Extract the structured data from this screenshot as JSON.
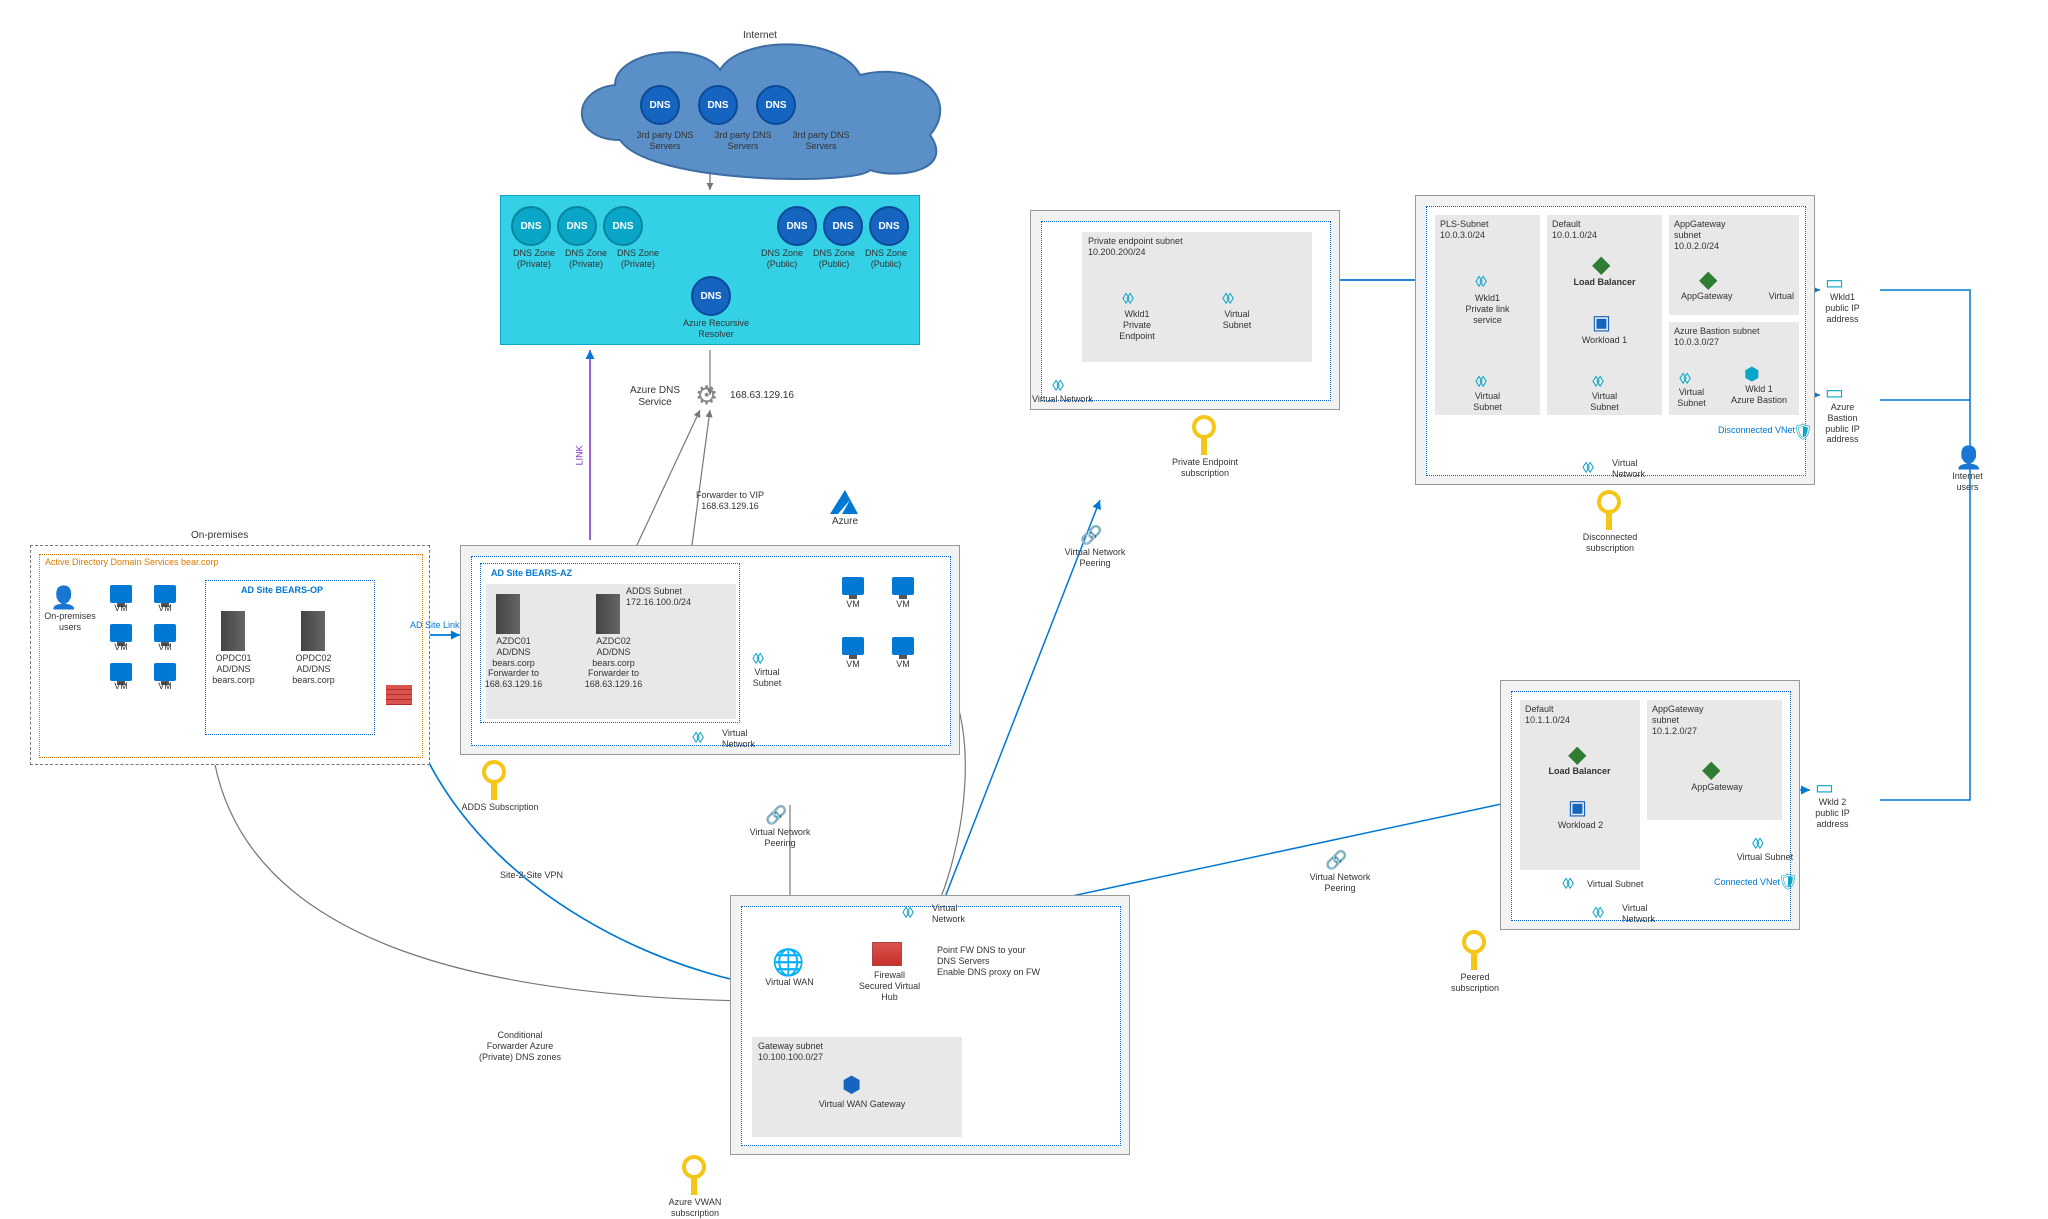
{
  "internet": {
    "title": "Internet",
    "dns_badge": "DNS",
    "servers": [
      "3rd party DNS\nServers",
      "3rd party DNS\nServers",
      "3rd party DNS\nServers"
    ]
  },
  "azure_dns_pane": {
    "resolver": "Azure Recursive\nResolver",
    "private_zones": [
      "DNS Zone\n(Private)",
      "DNS Zone\n(Private)",
      "DNS Zone\n(Private)"
    ],
    "public_zones": [
      "DNS Zone\n(Public)",
      "DNS Zone\n(Public)",
      "DNS Zone\n(Public)"
    ]
  },
  "azure_dns": {
    "title": "Azure DNS\nService",
    "ip": "168.63.129.16",
    "link_label": "LINK",
    "forwarder": "Forwarder to VIP\n168.63.129.16"
  },
  "azure_logo": "Azure",
  "onprem": {
    "title": "On-premises",
    "ad_title": "Active Directory Domain Services bear.corp",
    "users": "On-premises\nusers",
    "vm": "VM",
    "adsite": "AD Site BEARS-OP",
    "dc1": "OPDC01\nAD/DNS\nbears.corp",
    "dc2": "OPDC02\nAD/DNS\nbears.corp",
    "adsitelink": "AD Site Link"
  },
  "adds_sub": {
    "adsite": "AD Site BEARS-AZ",
    "subnet_title": "ADDS Subnet\n172.16.100.0/24",
    "dc1": "AZDC01\nAD/DNS\nbears.corp\nForwarder to\n168.63.129.16",
    "dc2": "AZDC02\nAD/DNS\nbears.corp\nForwarder to\n168.63.129.16",
    "vsubnet": "Virtual\nSubnet",
    "vm": "VM",
    "vnet": "Virtual Network",
    "sub": "ADDS Subscription"
  },
  "s2s": "Site-2-Site VPN",
  "cond_fwd": "Conditional\nForwarder Azure\n(Private) DNS zones",
  "peering": "Virtual Network\nPeering",
  "hub": {
    "vnet": "Virtual Network",
    "vwan": "Virtual WAN",
    "fw": "Firewall\nSecured Virtual\nHub",
    "fw_note": "Point FW DNS to your\nDNS Servers\nEnable DNS proxy on FW",
    "gw_subnet": "Gateway subnet\n10.100.100.0/27",
    "vwan_gw": "Virtual WAN Gateway",
    "sub": "Azure VWAN\nsubscription"
  },
  "pe_sub": {
    "subnet": "Private endpoint subnet\n10.200.200/24",
    "pe": "Wkld1\nPrivate\nEndpoint",
    "vsubnet": "Virtual\nSubnet",
    "vnet": "Virtual Network",
    "sub": "Private Endpoint\nsubscription"
  },
  "disc_sub": {
    "pls_subnet": "PLS-Subnet\n10.0.3.0/24",
    "default_subnet": "Default\n10.0.1.0/24",
    "appgw_subnet": "AppGateway\nsubnet\n10.0.2.0/24",
    "pls": "Wkld1\nPrivate link\nservice",
    "lb": "Load Balancer",
    "wl": "Workload 1",
    "appgw": "AppGateway",
    "virtual": "Virtual",
    "bastion_subnet": "Azure Bastion subnet\n10.0.3.0/27",
    "bastion": "Wkld 1\nAzure Bastion",
    "vsubnet": "Virtual\nSubnet",
    "disc_vnet": "Disconnected VNet",
    "vnet": "Virtual Network",
    "sub": "Disconnected\nsubscription"
  },
  "ip1": {
    "label": "Wkld1\npublic IP\naddress"
  },
  "ip2": {
    "label": "Azure\nBastion\npublic IP\naddress"
  },
  "ip3": {
    "label": "Wkld 2\npublic IP\naddress"
  },
  "internet_users": "Internet\nusers",
  "peered_sub": {
    "default_subnet": "Default\n10.1.1.0/24",
    "appgw_subnet": "AppGateway\nsubnet\n10.1.2.0/27",
    "lb": "Load Balancer",
    "wl": "Workload 2",
    "appgw": "AppGateway",
    "vsubnet": "Virtual Subnet",
    "conn_vnet": "Connected VNet",
    "vnet": "Virtual Network",
    "sub": "Peered\nsubscription"
  }
}
